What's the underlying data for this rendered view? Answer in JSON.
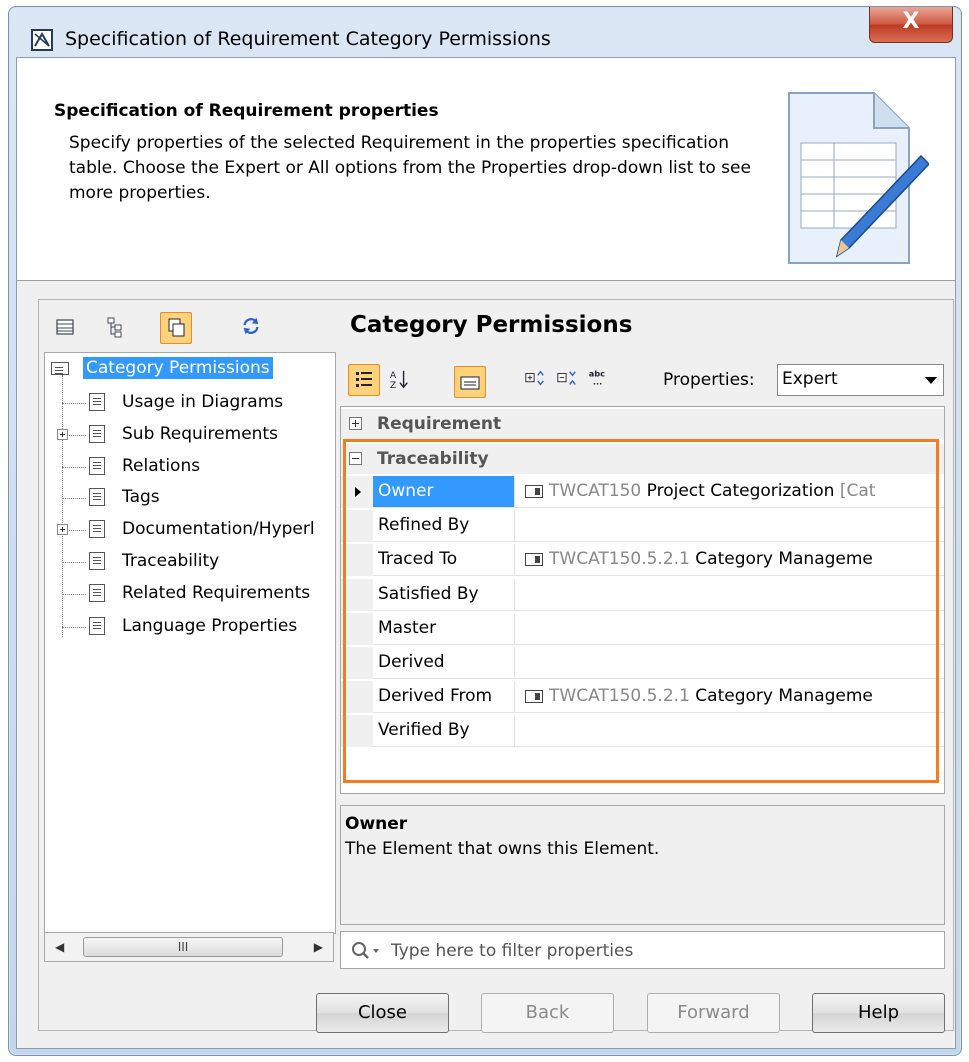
{
  "window": {
    "title": "Specification of Requirement Category Permissions",
    "close_glyph": "X"
  },
  "header": {
    "title": "Specification of Requirement properties",
    "description": "Specify properties of the selected Requirement in the properties specification table. Choose the Expert or All options from the Properties drop-down list to see more properties."
  },
  "panel": {
    "title": "Category Permissions"
  },
  "tree": {
    "items": [
      {
        "label": "Category Permissions"
      },
      {
        "label": "Usage in Diagrams"
      },
      {
        "label": "Sub Requirements"
      },
      {
        "label": "Relations"
      },
      {
        "label": "Tags"
      },
      {
        "label": "Documentation/Hyperl"
      },
      {
        "label": "Traceability"
      },
      {
        "label": "Related Requirements"
      },
      {
        "label": "Language Properties"
      }
    ],
    "scroll_thumb": "III"
  },
  "properties": {
    "label": "Properties:",
    "selected": "Expert"
  },
  "grid": {
    "groups": [
      {
        "name": "Requirement"
      },
      {
        "name": "Traceability"
      }
    ],
    "rows": [
      {
        "name": "Owner",
        "id": "TWCAT150",
        "text": " Project Categorization",
        "tail": " [Cat"
      },
      {
        "name": "Refined By"
      },
      {
        "name": "Traced To",
        "id": "TWCAT150.5.2.1",
        "text": " Category Manageme"
      },
      {
        "name": "Satisfied By"
      },
      {
        "name": "Master"
      },
      {
        "name": "Derived"
      },
      {
        "name": "Derived From",
        "id": "TWCAT150.5.2.1",
        "text": " Category Manageme"
      },
      {
        "name": "Verified By"
      }
    ]
  },
  "description": {
    "title": "Owner",
    "text": "The Element that owns this Element."
  },
  "filter": {
    "placeholder": "Type here to filter properties"
  },
  "buttons": {
    "close": "Close",
    "back": "Back",
    "forward": "Forward",
    "help": "Help"
  },
  "colors": {
    "highlight": "#f47c20",
    "selection": "#3399ff"
  }
}
